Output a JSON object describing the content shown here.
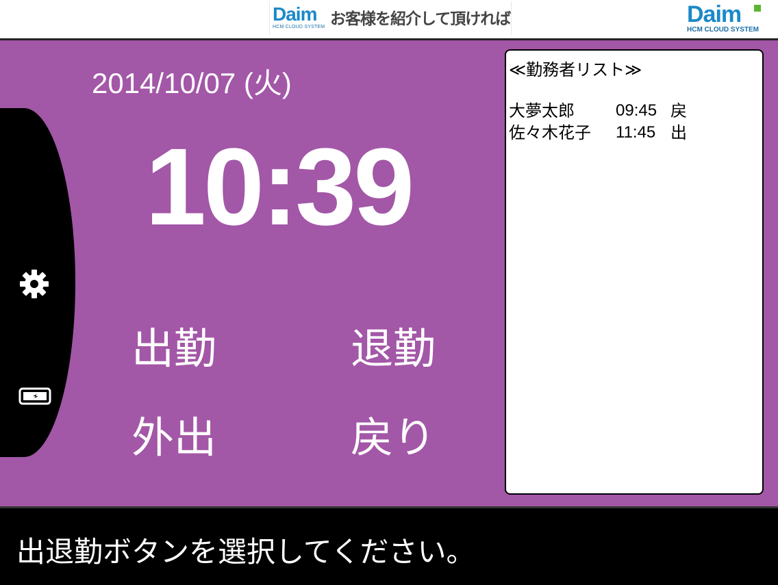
{
  "banner": {
    "ad_logo_text": "Daim",
    "ad_logo_sub": "HCM CLOUD SYSTEM",
    "ad_text": "お客様を紹介して頂ければ"
  },
  "brand": {
    "logo_text": "Daim",
    "logo_sub": "HCM CLOUD SYSTEM"
  },
  "date": "2014/10/07 (火)",
  "clock": "10:39",
  "actions": {
    "clock_in": "出勤",
    "clock_out": "退勤",
    "go_out": "外出",
    "return": "戻り"
  },
  "worker_list": {
    "title": "≪勤務者リスト≫",
    "rows": [
      {
        "name": "大夢太郎",
        "time": "09:45",
        "status": "戻"
      },
      {
        "name": "佐々木花子",
        "time": "11:45",
        "status": "出"
      }
    ]
  },
  "message": "出退勤ボタンを選択してください。",
  "colors": {
    "background": "#a357a7",
    "brand_blue": "#1a89c9",
    "brand_green": "#5cb531"
  },
  "icons": [
    "gear-icon",
    "battery-icon"
  ]
}
